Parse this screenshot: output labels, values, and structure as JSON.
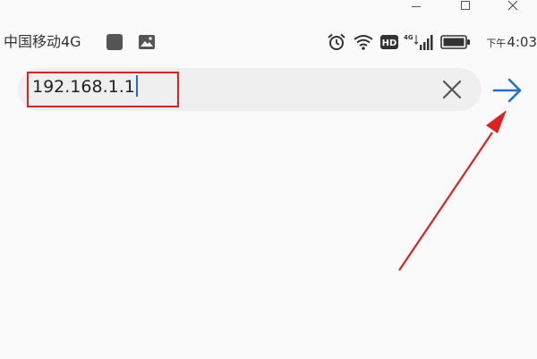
{
  "status_bar": {
    "carrier": "中国移动4G",
    "time_period": "下午",
    "time": "4:03",
    "hd_badge": "HD",
    "network_type": "4G",
    "icons": [
      "app-notification-icon",
      "image-icon",
      "alarm-icon",
      "wifi-icon",
      "hd-icon",
      "signal-icon",
      "battery-icon"
    ]
  },
  "window_controls": {
    "icons": [
      "minimize-icon",
      "maximize-icon",
      "close-icon"
    ]
  },
  "address_bar": {
    "url": "192.168.1.1",
    "clear_icon": "clear-icon",
    "go_icon": "go-arrow-icon"
  },
  "annotation": {
    "color": "#e02020",
    "highlight": "url-box",
    "arrow_target": "go-button"
  },
  "colors": {
    "accent": "#1e6fd9",
    "annotation_red": "#e02020",
    "address_bar_bg": "#efefef",
    "page_bg": "#fafafa"
  }
}
